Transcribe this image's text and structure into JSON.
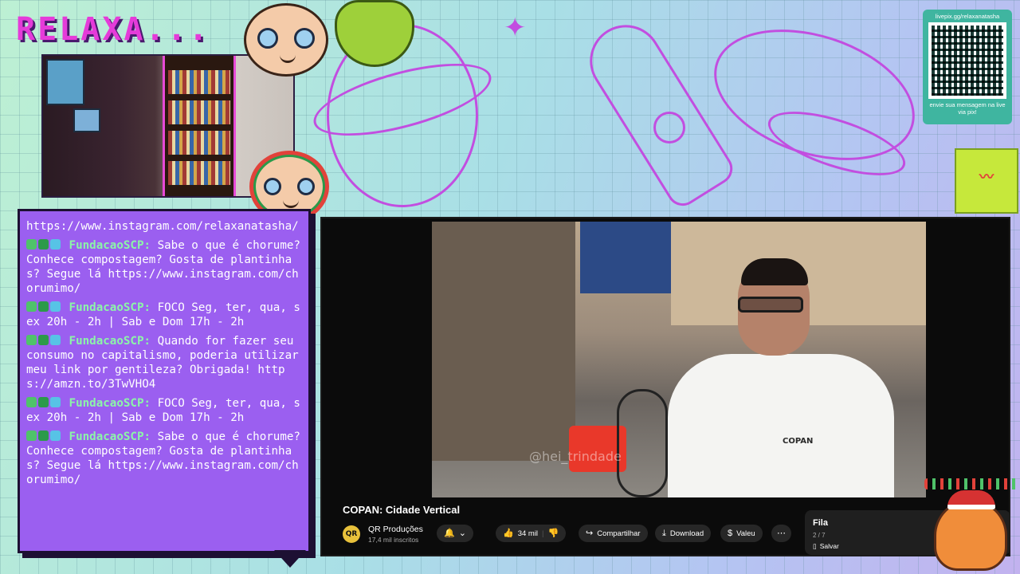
{
  "overlay": {
    "logo_text": "RELAXA...",
    "qr": {
      "url": "livepix.gg/relaxanatasha",
      "caption": "envie sua mensagem na live via pix!"
    }
  },
  "chat": {
    "messages": [
      {
        "user": "",
        "text": "https://www.instagram.com/relaxanatasha/"
      },
      {
        "user": "FundacaoSCP:",
        "text": "Sabe o que é chorume? Conhece compostagem? Gosta de plantinhas? Segue lá https://www.instagram.com/chorumimo/"
      },
      {
        "user": "FundacaoSCP:",
        "text": "FOCO Seg, ter, qua, sex 20h - 2h | Sab e Dom 17h - 2h"
      },
      {
        "user": "FundacaoSCP:",
        "text": "Quando for fazer seu consumo no capitalismo, poderia utilizar meu link por gentileza? Obrigada! https://amzn.to/3TwVHO4"
      },
      {
        "user": "FundacaoSCP:",
        "text": "FOCO Seg, ter, qua, sex 20h - 2h | Sab e Dom 17h - 2h"
      },
      {
        "user": "FundacaoSCP:",
        "text": "Sabe o que é chorume? Conhece compostagem? Gosta de plantinhas? Segue lá https://www.instagram.com/chorumimo/"
      }
    ],
    "badge_colors": [
      "#4fc36a",
      "#2c9a4a",
      "#57c3e6"
    ]
  },
  "player": {
    "video_title": "COPAN: Cidade Vertical",
    "channel": {
      "name": "QR Produções",
      "subscribers": "17,4 mil inscritos",
      "avatar_text": "QR"
    },
    "likes": "34 mil",
    "share_label": "Compartilhar",
    "download_label": "Download",
    "thanks_label": "Valeu",
    "watermark": "@hei_trindade",
    "shirt_text": "COPAN",
    "queue": {
      "title": "Fila",
      "position": "2 / 7",
      "save_label": "Salvar"
    }
  },
  "colors": {
    "logo": "#e53bd9",
    "chat_bg": "#9b5ff0",
    "username": "#8cf5a8",
    "qr_bg": "#3fb5a0"
  }
}
